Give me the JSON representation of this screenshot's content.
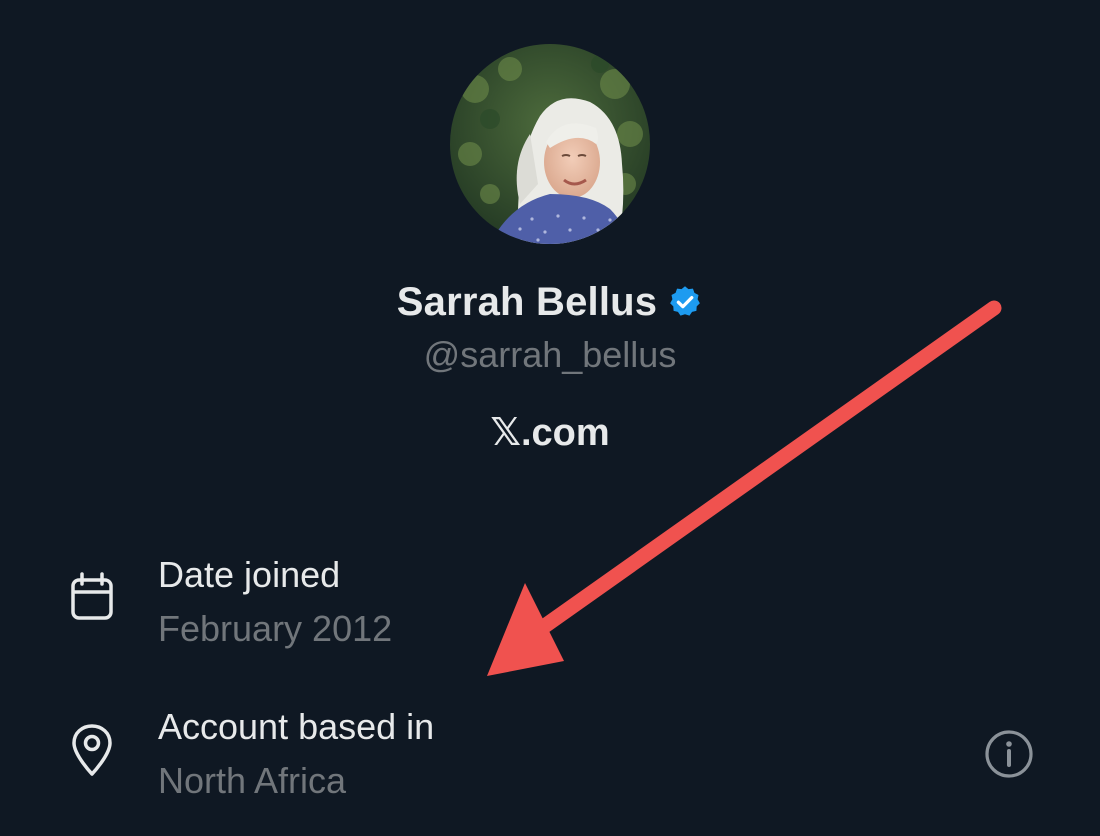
{
  "profile": {
    "display_name": "Sarrah Bellus",
    "handle": "@sarrah_bellus",
    "site": "𝕏.com",
    "verified": true
  },
  "about": {
    "date_joined_label": "Date joined",
    "date_joined_value": "February 2012",
    "account_based_label": "Account based in",
    "account_based_value": "North Africa"
  },
  "icons": {
    "verified": "verified-badge-icon",
    "calendar": "calendar-icon",
    "location": "location-pin-icon",
    "info": "info-icon"
  },
  "colors": {
    "background": "#0f1823",
    "primary_text": "#e7e9ea",
    "secondary_text": "#71767b",
    "verified_blue": "#1d9bf0",
    "annotation_arrow": "#f0524f"
  }
}
